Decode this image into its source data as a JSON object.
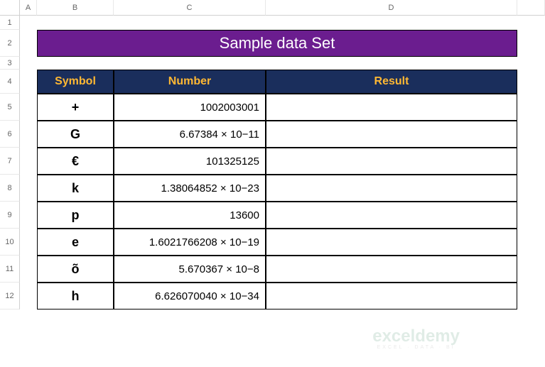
{
  "columns": [
    "A",
    "B",
    "C",
    "D"
  ],
  "rows": [
    "1",
    "2",
    "3",
    "4",
    "5",
    "6",
    "7",
    "8",
    "9",
    "10",
    "11",
    "12"
  ],
  "title": "Sample data Set",
  "headers": {
    "symbol": "Symbol",
    "number": "Number",
    "result": "Result"
  },
  "data": [
    {
      "symbol": "+",
      "number": "1002003001",
      "result": ""
    },
    {
      "symbol": "G",
      "number": "6.67384 × 10−11",
      "result": ""
    },
    {
      "symbol": "€",
      "number": "101325125",
      "result": ""
    },
    {
      "symbol": "k",
      "number": "1.38064852 × 10−23",
      "result": ""
    },
    {
      "symbol": "p",
      "number": "13600",
      "result": ""
    },
    {
      "symbol": "e",
      "number": "1.6021766208 × 10−19",
      "result": ""
    },
    {
      "symbol": "õ",
      "number": "5.670367 × 10−8",
      "result": ""
    },
    {
      "symbol": "h",
      "number": "6.626070040 × 10−34",
      "result": ""
    }
  ],
  "watermark": {
    "title": "exceldemy",
    "subtitle": "EXCEL · DATA · BI"
  }
}
